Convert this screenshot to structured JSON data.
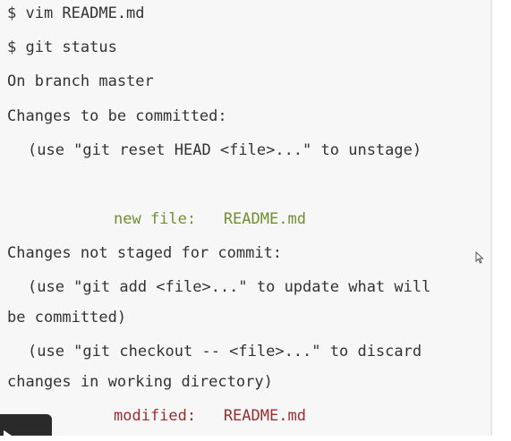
{
  "terminal": {
    "lines": {
      "cmd_vim": "$ vim README.md",
      "cmd_git_status": "$ git status",
      "branch": "On branch master",
      "staged_header": "Changes to be committed:",
      "staged_hint": "(use \"git reset HEAD <file>...\" to unstage)",
      "staged_file": "new file:   README.md",
      "unstaged_header": "Changes not staged for commit:",
      "unstaged_hint1_a": "(use \"git add <file>...\" to update what will",
      "unstaged_hint1_b": "be committed)",
      "unstaged_hint2_a": "(use \"git checkout -- <file>...\" to discard",
      "unstaged_hint2_b": "changes in working directory)",
      "modified_file": "modified:   README.md"
    }
  },
  "colors": {
    "text": "#333333",
    "staged_file": "#6f8f32",
    "modified_file": "#9b2d2d",
    "panel_background": "#f7f7f7"
  },
  "icons": {
    "cursor": "mouse-pointer-icon",
    "play": "play-icon"
  }
}
